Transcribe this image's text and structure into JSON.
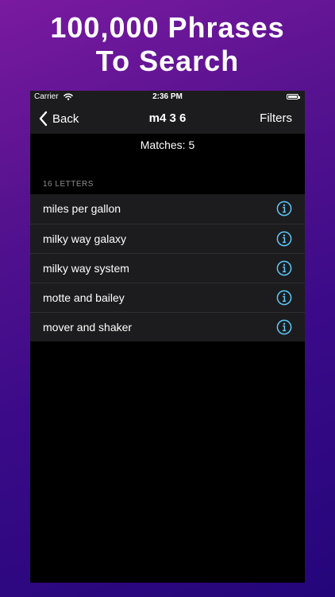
{
  "headline": {
    "line1": "100,000 Phrases",
    "line2": "To Search"
  },
  "status_bar": {
    "carrier": "Carrier",
    "time": "2:36 PM",
    "wifi_icon": "wifi-icon",
    "battery_icon": "battery-icon"
  },
  "nav": {
    "back_label": "Back",
    "back_icon": "chevron-left-icon",
    "title": "m4 3 6",
    "filters_label": "Filters"
  },
  "matches_text": "Matches: 5",
  "section": {
    "header": "16 LETTERS",
    "items": [
      {
        "label": "miles per gallon"
      },
      {
        "label": "milky way galaxy"
      },
      {
        "label": "milky way system"
      },
      {
        "label": "motte and bailey"
      },
      {
        "label": "mover and shaker"
      }
    ],
    "item_icon": "info-icon"
  },
  "colors": {
    "accent": "#5ac8fa",
    "bar_background": "#1c1c1e",
    "secondary_text": "#8e8e93"
  }
}
